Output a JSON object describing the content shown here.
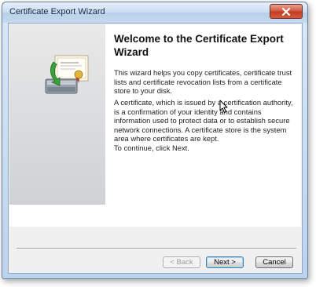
{
  "window": {
    "title": "Certificate Export Wizard"
  },
  "wizard": {
    "heading": "Welcome to the Certificate Export Wizard",
    "paragraph1": "This wizard helps you copy certificates, certificate trust lists and certificate revocation lists from a certificate store to your disk.",
    "paragraph2": "A certificate, which is issued by a certification authority, is a confirmation of your identity and contains information used to protect data or to establish secure network connections. A certificate store is the system area where certificates are kept.",
    "paragraph3": "To continue, click Next."
  },
  "buttons": {
    "back_label": "< Back",
    "next_label": "Next >",
    "cancel_label": "Cancel"
  },
  "icons": {
    "close": "close-icon",
    "wizard_graphic": "certificate-export-icon",
    "cursor": "mouse-pointer-icon"
  },
  "colors": {
    "close_button": "#c23a22",
    "title_bar": "#c9dcf1",
    "default_button_border": "#3c7fb1"
  }
}
